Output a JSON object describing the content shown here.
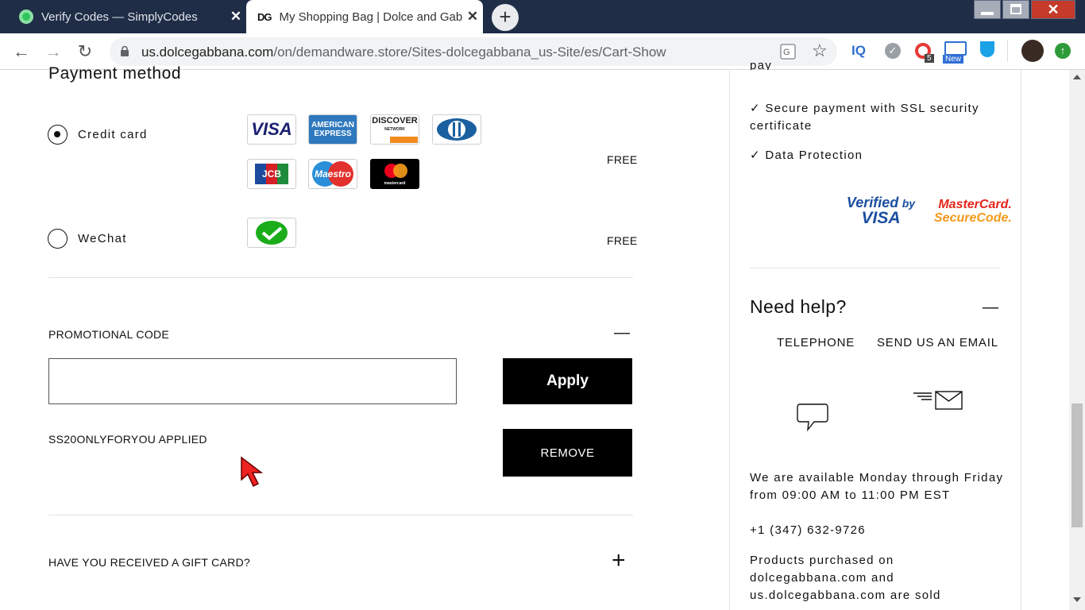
{
  "browser": {
    "tabs": [
      {
        "title": "Verify Codes — SimplyCodes",
        "close": "✕"
      },
      {
        "title": "My Shopping Bag | Dolce and Gabbana",
        "favicon": "DG",
        "close": "✕"
      }
    ],
    "new_tab": "+",
    "window_close": "✕",
    "url_domain": "us.dolcegabbana.com",
    "url_path": "/on/demandware.store/Sites-dolcegabbana_us-Site/es/Cart-Show",
    "extensions": {
      "iq": "IQ",
      "badge_count": "5",
      "new_badge": "New"
    }
  },
  "payment": {
    "heading": "Payment method",
    "methods": [
      {
        "label": "Credit card",
        "price": "FREE",
        "selected": true
      },
      {
        "label": "WeChat",
        "price": "FREE",
        "selected": false
      }
    ],
    "cards": {
      "visa": "VISA",
      "amex_top": "AMERICAN",
      "amex_bottom": "EXPRESS",
      "discover": "DISCOVER",
      "discover_sub": "NETWORK",
      "jcb": "JCB",
      "maestro": "Maestro",
      "mastercard": "mastercard"
    }
  },
  "promo": {
    "title": "PROMOTIONAL CODE",
    "input_value": "",
    "apply_label": "Apply",
    "applied_text": "SS20ONLYFORYOU APPLIED",
    "remove_label": "REMOVE",
    "collapse_symbol": "—"
  },
  "gift": {
    "title": "HAVE YOU RECEIVED A GIFT CARD?",
    "expand_symbol": "+"
  },
  "sidebar": {
    "truncated_top": "pay",
    "secure_items": [
      "Secure payment with SSL security certificate",
      "Data Protection"
    ],
    "check": "✓",
    "verified_top": "Verified",
    "verified_by": "by",
    "verified_visa": "VISA",
    "mc_top": "MasterCard.",
    "mc_bottom": "SecureCode.",
    "help_title": "Need help?",
    "help_collapse": "—",
    "telephone_label": "TELEPHONE",
    "email_label": "SEND US AN EMAIL",
    "availability": "We are available Monday through Friday from 09:00 AM to 11:00 PM EST",
    "phone": "+1 (347) 632-9726",
    "products_note": "Products purchased on dolcegabbana.com and us.dolcegabbana.com are sold"
  },
  "colors": {
    "tabbar": "#1f2d47",
    "accent_black": "#000000",
    "divider": "#e3e3e3"
  }
}
